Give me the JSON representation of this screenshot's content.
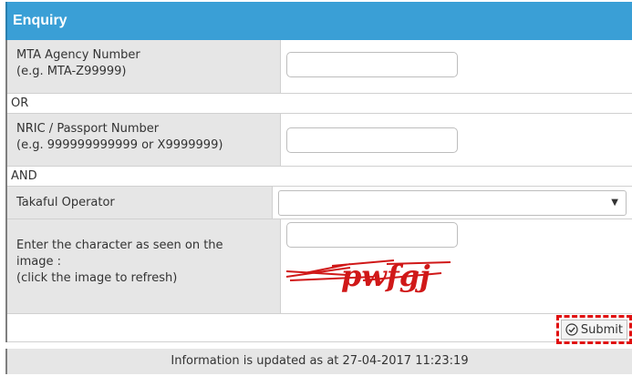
{
  "header": {
    "title": "Enquiry"
  },
  "form": {
    "agency_label": "MTA Agency Number",
    "agency_hint": "(e.g. MTA-Z99999)",
    "agency_value": "",
    "or_text": "OR",
    "nric_label": "NRIC / Passport Number",
    "nric_hint": "(e.g. 999999999999 or X9999999)",
    "nric_value": "",
    "and_text": "AND",
    "operator_label": "Takaful Operator",
    "operator_selected": "",
    "captcha_label_1": "Enter the character as seen on the",
    "captcha_label_2": "image :",
    "captcha_label_3": "(click the image to refresh)",
    "captcha_value": "",
    "captcha_text": "pwfgj",
    "submit_label": "Submit"
  },
  "footer": {
    "text": "Information is updated as at 27-04-2017 11:23:19"
  },
  "colors": {
    "header": "#3a9fd6",
    "label_bg": "#e6e6e6",
    "highlight": "#e01010",
    "captcha": "#d01818"
  }
}
